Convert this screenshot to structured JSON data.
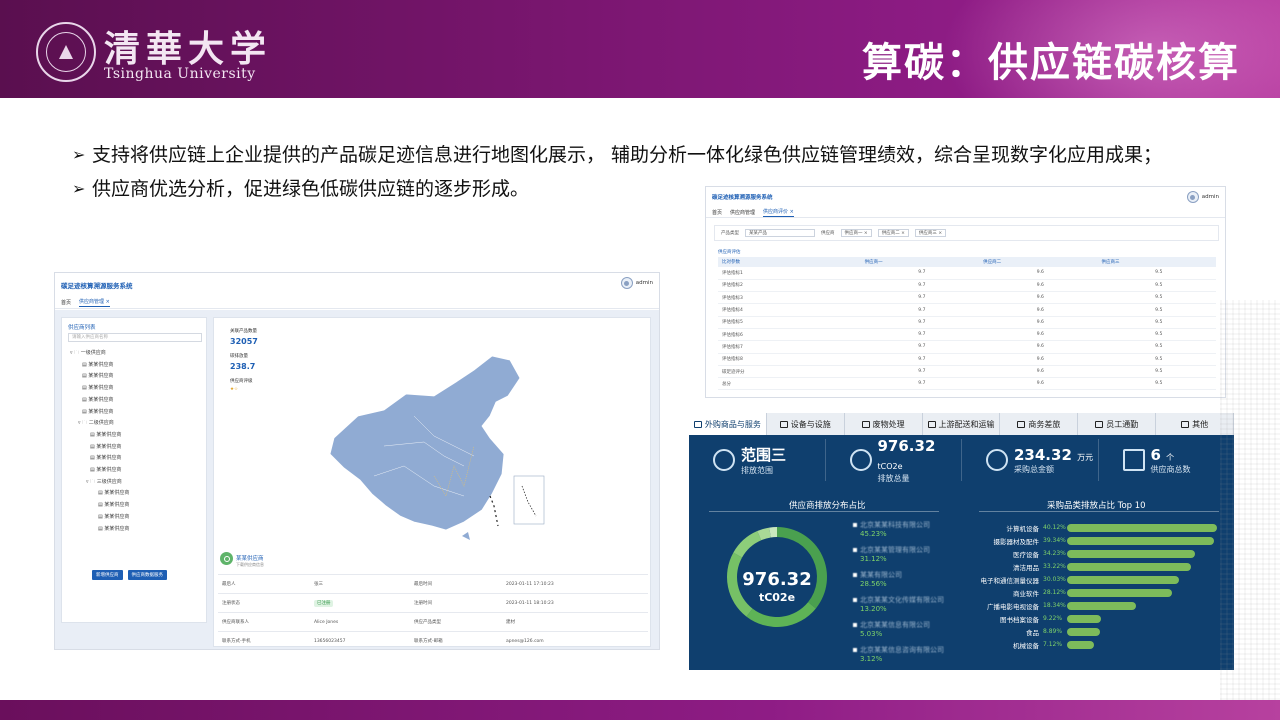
{
  "header": {
    "logo_cn": "清華大学",
    "logo_en": "Tsinghua University",
    "title": "算碳：供应链碳核算"
  },
  "bullets": [
    "支持将供应链上企业提供的产品碳足迹信息进行地图化展示， 辅助分析一体化绿色供应链管理绩效，综合呈现数字化应用成果；",
    "供应商优选分析，促进绿色低碳供应链的逐步形成。"
  ],
  "shot1": {
    "app_title": "碳足迹核算溯源服务系统",
    "user": "admin",
    "tabs": [
      "首页",
      "供应商管理 ×"
    ],
    "left_title": "供应商列表",
    "search_placeholder": "请输入供应商名称",
    "tree": [
      "一级供应商",
      "某某供应商",
      "某某供应商",
      "某某供应商",
      "某某供应商",
      "某某供应商",
      "二级供应商",
      "某某供应商",
      "某某供应商",
      "某某供应商",
      "某某供应商",
      "三级供应商",
      "某某供应商",
      "某某供应商",
      "某某供应商",
      "某某供应商"
    ],
    "btn_add": "新增供应商",
    "btn_import": "供应商数据服务",
    "stat1_label": "关联产品数量",
    "stat1_val": "32057",
    "stat2_label": "碳排放量",
    "stat2_val": "238.7",
    "stat3_label": "供应商评级",
    "supplier_name": "某某供应商",
    "supplier_sub": "下载供应商信息",
    "rows": [
      [
        "最后人",
        "张三",
        "最后时间",
        "2023-01-11 17:10:23"
      ],
      [
        "注册状态",
        "已注册",
        "注册时间",
        "2023-01-11 18:10:23"
      ],
      [
        "供应商联系人",
        "Alice Jones",
        "供应产品类型",
        "建材"
      ],
      [
        "联系方式-手机",
        "13656023457",
        "联系方式-邮箱",
        "apnes@126.com"
      ]
    ]
  },
  "shot2": {
    "app_title": "碳足迹核算溯源服务系统",
    "user": "admin",
    "tabs": [
      "首页",
      "供应商管理",
      "供应商评价 ×"
    ],
    "filter_product_label": "产品类型",
    "filter_product_val": "某某产品",
    "filter_supplier_label": "供应商",
    "filter_tags": [
      "供应商一 ×",
      "供应商二 ×",
      "供应商三 ×"
    ],
    "table_title": "供应商评估",
    "columns": [
      "比对参数",
      "供应商一",
      "供应商二",
      "供应商三"
    ],
    "table_rows": [
      [
        "评估指标1",
        "9.7",
        "9.6",
        "9.5"
      ],
      [
        "评估指标2",
        "9.7",
        "9.6",
        "9.5"
      ],
      [
        "评估指标3",
        "9.7",
        "9.6",
        "9.5"
      ],
      [
        "评估指标4",
        "9.7",
        "9.6",
        "9.5"
      ],
      [
        "评估指标5",
        "9.7",
        "9.6",
        "9.5"
      ],
      [
        "评估指标6",
        "9.7",
        "9.6",
        "9.5"
      ],
      [
        "评估指标7",
        "9.7",
        "9.6",
        "9.5"
      ],
      [
        "评估指标8",
        "9.7",
        "9.6",
        "9.5"
      ],
      [
        "碳足迹评分",
        "9.7",
        "9.6",
        "9.5"
      ],
      [
        "总分",
        "9.7",
        "9.6",
        "9.5"
      ]
    ]
  },
  "shot3": {
    "tabs": [
      "外购商品与服务",
      "设备与设施",
      "废物处理",
      "上游配送和运输",
      "商务差旅",
      "员工通勤",
      "其他"
    ],
    "kpis": [
      {
        "big": "范围三",
        "unit": "",
        "sub": "排放范围"
      },
      {
        "big": "976.32",
        "unit": "tCO2e",
        "sub": "排放总量"
      },
      {
        "big": "234.32",
        "unit": "万元",
        "sub": "采购总金额"
      },
      {
        "big": "6",
        "unit": "个",
        "sub": "供应商总数"
      }
    ],
    "left_section": "供应商排放分布占比",
    "right_section": "采购品类排放占比 Top 10",
    "donut_value": "976.32",
    "donut_unit": "tC02e",
    "legend": [
      {
        "name": "北京某某科技有限公司",
        "pct": "45.23%"
      },
      {
        "name": "北京某某管理有限公司",
        "pct": "31.12%"
      },
      {
        "name": "某某有限公司",
        "pct": "28.56%"
      },
      {
        "name": "北京某某文化传媒有限公司",
        "pct": "13.20%"
      },
      {
        "name": "北京某某信息有限公司",
        "pct": "5.03%"
      },
      {
        "name": "北京某某信息咨询有限公司",
        "pct": "3.12%"
      }
    ],
    "bars": [
      {
        "label": "计算机设备",
        "pct": "40.12%",
        "value": 40.12
      },
      {
        "label": "摄影器材及配件",
        "pct": "39.34%",
        "value": 39.34
      },
      {
        "label": "医疗设备",
        "pct": "34.23%",
        "value": 34.23
      },
      {
        "label": "清洁用品",
        "pct": "33.22%",
        "value": 33.22
      },
      {
        "label": "电子和通信测量仪器",
        "pct": "30.03%",
        "value": 30.03
      },
      {
        "label": "商业软件",
        "pct": "28.12%",
        "value": 28.12
      },
      {
        "label": "广播电影电视设备",
        "pct": "18.34%",
        "value": 18.34
      },
      {
        "label": "图书档案设备",
        "pct": "9.22%",
        "value": 9.22
      },
      {
        "label": "食品",
        "pct": "8.89%",
        "value": 8.89
      },
      {
        "label": "机械设备",
        "pct": "7.12%",
        "value": 7.12
      }
    ],
    "donut_segments": [
      45.23,
      31.12,
      28.56,
      13.2,
      5.03,
      3.12
    ]
  },
  "colors": {
    "brand": "#7a1670",
    "accent": "#1e5fb4",
    "dash_bg": "#0f3f6e",
    "bar": "#7dbb5b"
  }
}
